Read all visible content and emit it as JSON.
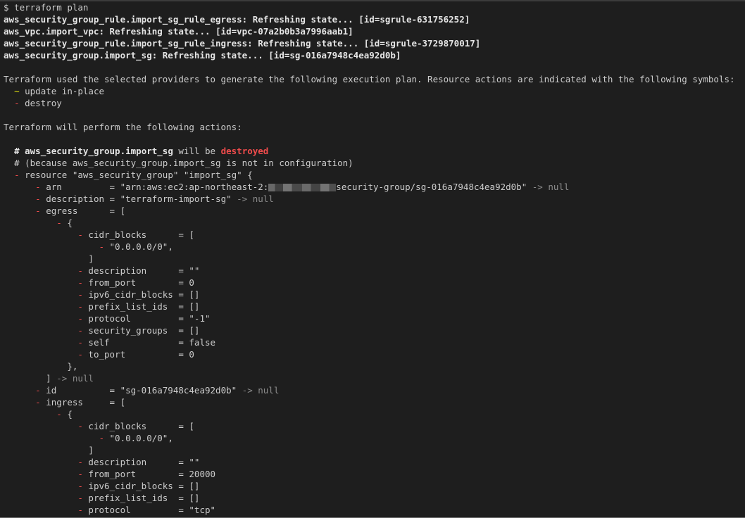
{
  "terminal": {
    "prompt": "$",
    "command": "terraform plan",
    "refresh_lines": [
      "aws_security_group_rule.import_sg_rule_egress: Refreshing state... [id=sgrule-631756252]",
      "aws_vpc.import_vpc: Refreshing state... [id=vpc-07a2b0b3a7996aab1]",
      "aws_security_group_rule.import_sg_rule_ingress: Refreshing state... [id=sgrule-3729870017]",
      "aws_security_group.import_sg: Refreshing state... [id=sg-016a7948c4ea92d0b]"
    ],
    "providers_msg": "Terraform used the selected providers to generate the following execution plan. Resource actions are indicated with the following symbols:",
    "legend": {
      "update_symbol": "~",
      "update_text": "update in-place",
      "destroy_symbol": "-",
      "destroy_text": "destroy"
    },
    "perform_msg": "Terraform will perform the following actions:",
    "comment_hash": "#",
    "resource_addr": "aws_security_group.import_sg",
    "will_be": "will be",
    "destroyed": "destroyed",
    "because_comment": "# (because aws_security_group.import_sg is not in configuration)",
    "resource_decl": "resource \"aws_security_group\" \"import_sg\" {",
    "arn": {
      "key": "arn         = ",
      "value_start": "\"arn:aws:ec2:ap-northeast-2:",
      "value_end": "security-group/sg-016a7948c4ea92d0b\"",
      "arrow_null": " -> null"
    },
    "description": {
      "key": "description = ",
      "value": "\"terraform-import-sg\"",
      "arrow_null": " -> null"
    },
    "egress_open": "egress      = [",
    "brace_open": "{",
    "cidr_blocks_open": "cidr_blocks      = [",
    "cidr_value": "\"0.0.0.0/0\",",
    "bracket_close": "]",
    "egress_rule": {
      "description": "description      = \"\"",
      "from_port": "from_port        = 0",
      "ipv6_cidr_blocks": "ipv6_cidr_blocks = []",
      "prefix_list_ids": "prefix_list_ids  = []",
      "protocol": "protocol         = \"-1\"",
      "security_groups": "security_groups  = []",
      "self": "self             = false",
      "to_port": "to_port          = 0"
    },
    "brace_close_comma": "},",
    "arrow_null": " -> null",
    "id": {
      "key": "id          = ",
      "value": "\"sg-016a7948c4ea92d0b\"",
      "arrow_null": " -> null"
    },
    "ingress_open": "ingress     = [",
    "ingress_rule": {
      "description": "description      = \"\"",
      "from_port": "from_port        = 20000",
      "ipv6_cidr_blocks": "ipv6_cidr_blocks = []",
      "prefix_list_ids": "prefix_list_ids  = []",
      "protocol": "protocol         = \"tcp\""
    }
  },
  "colors": {
    "background": "#1e1e1e",
    "text": "#cccccc",
    "destroy_red": "#f14c4c",
    "update_yellow": "#e5e510",
    "null_gray": "#8c8c8c"
  }
}
